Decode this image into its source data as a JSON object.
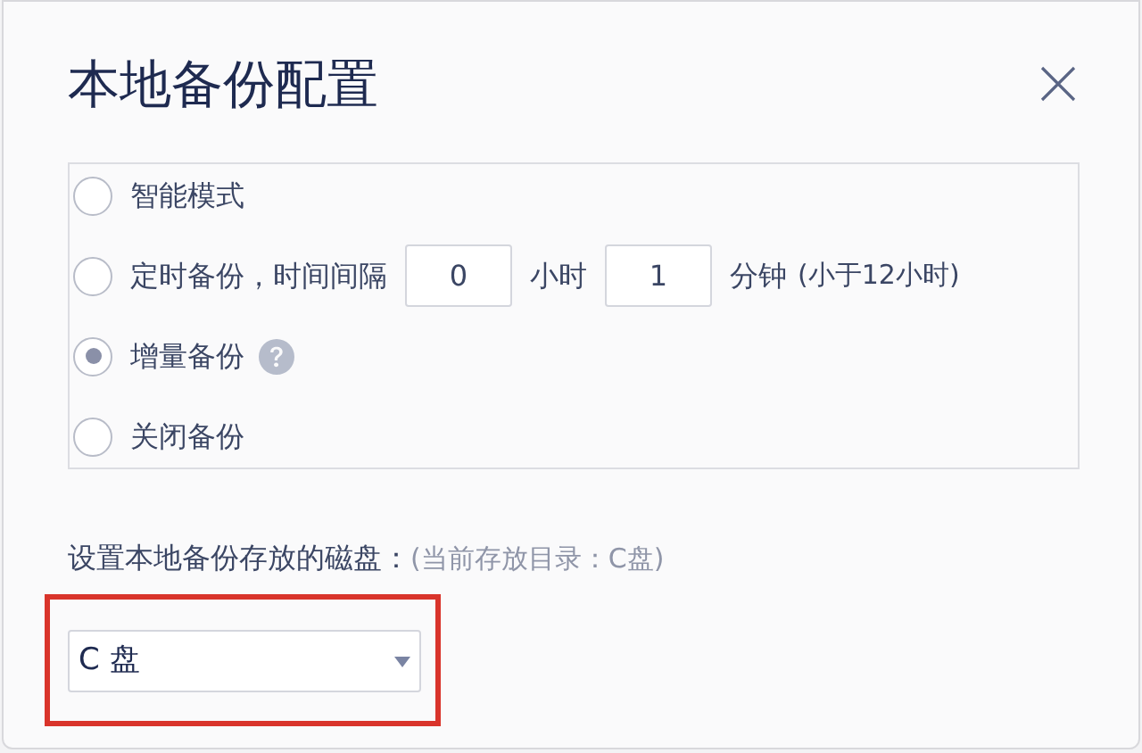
{
  "dialog": {
    "title": "本地备份配置"
  },
  "modes": [
    {
      "kind": "plain",
      "label": "智能模式",
      "selected": false
    },
    {
      "kind": "interval",
      "label": "定时备份，时间间隔",
      "hours": "0",
      "hours_unit": "小时",
      "minutes": "1",
      "minutes_unit": "分钟",
      "note": "(小于12小时)",
      "selected": false
    },
    {
      "kind": "help",
      "label": "增量备份",
      "selected": true
    },
    {
      "kind": "plain",
      "label": "关闭备份",
      "selected": false
    }
  ],
  "disk": {
    "label": "设置本地备份存放的磁盘：",
    "current": "(当前存放目录：C盘)",
    "value": "C 盘",
    "highlighted": true
  }
}
